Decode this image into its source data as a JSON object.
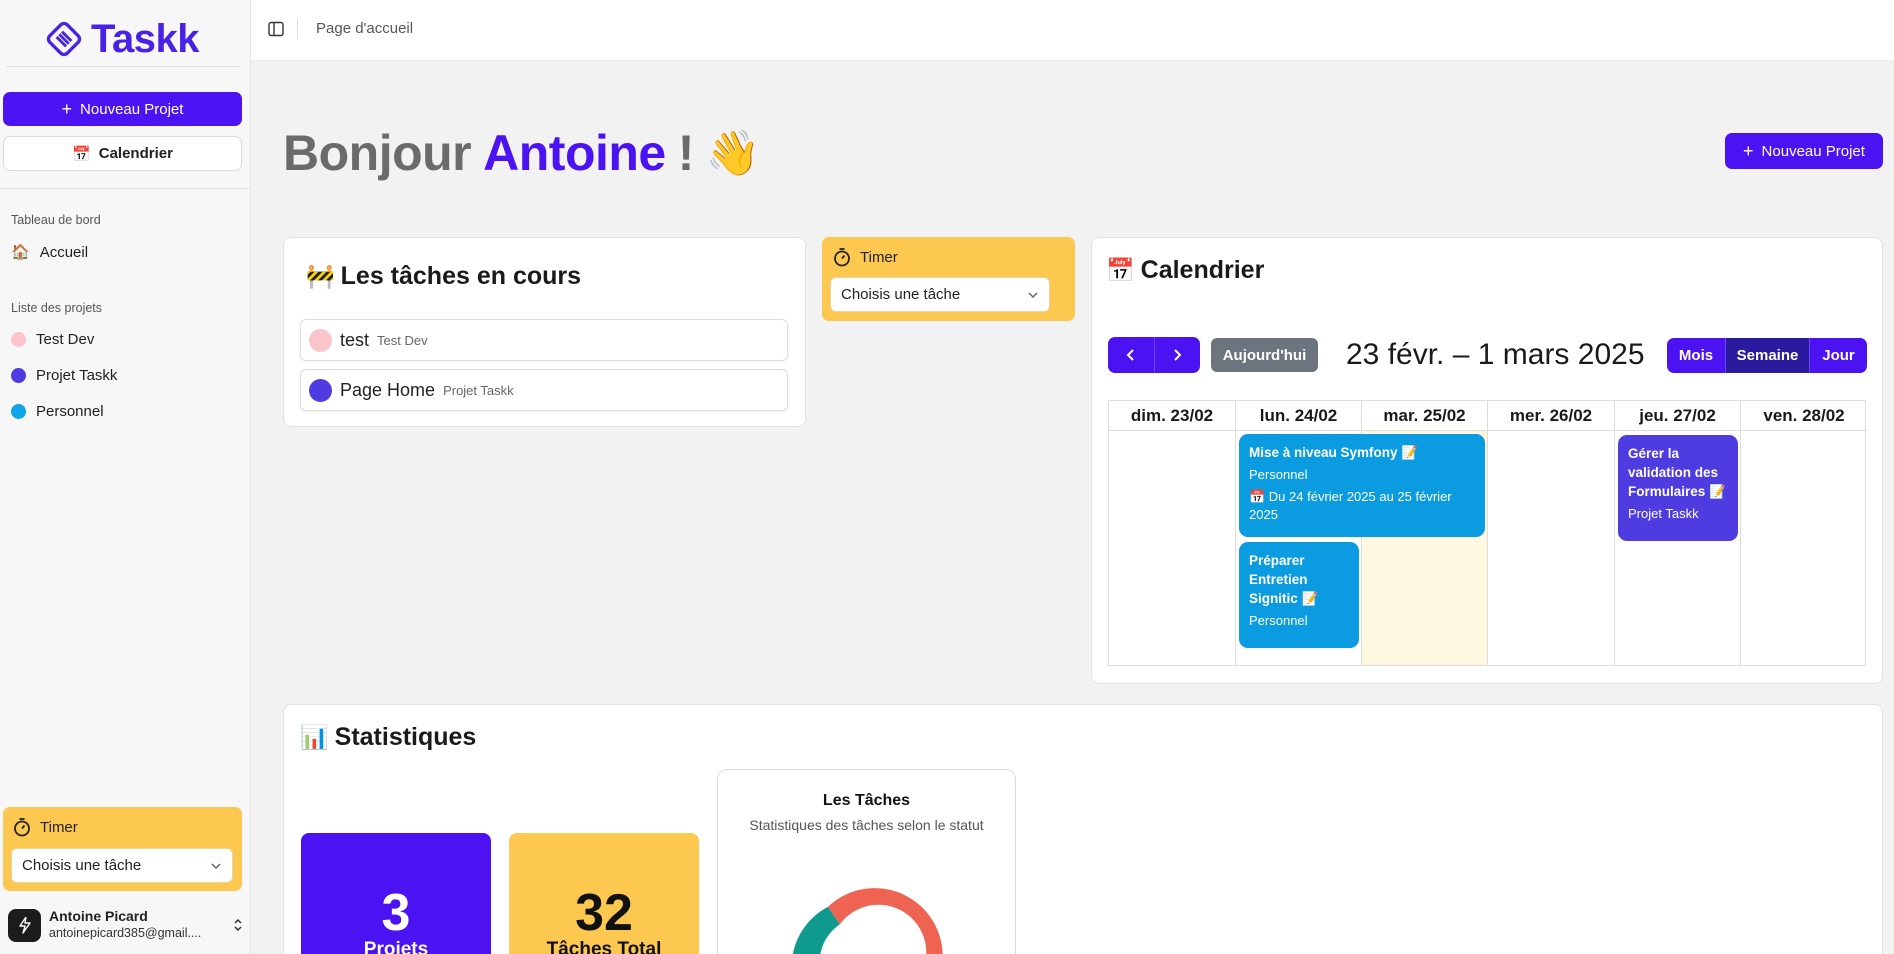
{
  "app": {
    "name": "Taskk"
  },
  "sidebar": {
    "new_project_label": "Nouveau Projet",
    "calendar_label": "Calendrier",
    "groups": [
      {
        "title": "Tableau de bord",
        "items": [
          {
            "label": "Accueil",
            "icon": "house-emoji"
          }
        ]
      },
      {
        "title": "Liste des projets",
        "items": [
          {
            "label": "Test Dev",
            "color": "#fbc4cb"
          },
          {
            "label": "Projet Taskk",
            "color": "#4f3ce0"
          },
          {
            "label": "Personnel",
            "color": "#0ea5e9"
          }
        ]
      }
    ],
    "timer": {
      "title": "Timer",
      "select_value": "Choisis une tâche"
    },
    "user": {
      "name": "Antoine Picard",
      "email": "antoinepicard385@gmail...."
    }
  },
  "topbar": {
    "breadcrumb": "Page d'accueil"
  },
  "greeting": {
    "prefix": "Bonjour",
    "name": "Antoine",
    "suffix": "!",
    "emoji": "👋"
  },
  "header_button": {
    "label": "Nouveau Projet"
  },
  "tasks_card": {
    "emoji": "🚧",
    "title": "Les tâches en cours",
    "items": [
      {
        "name": "test",
        "project": "Test Dev",
        "color": "#fbc4cb"
      },
      {
        "name": "Page Home",
        "project": "Projet Taskk",
        "color": "#4f3ce0"
      }
    ]
  },
  "timer_card": {
    "title": "Timer",
    "select_value": "Choisis une tâche"
  },
  "calendar": {
    "emoji": "📅",
    "title": "Calendrier",
    "today_label": "Aujourd'hui",
    "range": "23 févr. – 1 mars 2025",
    "views": [
      "Mois",
      "Semaine",
      "Jour"
    ],
    "active_view": "Semaine",
    "days": [
      "dim. 23/02",
      "lun. 24/02",
      "mar. 25/02",
      "mer. 26/02",
      "jeu. 27/02",
      "ven. 28/02"
    ],
    "today_index": 2,
    "events": [
      {
        "title": "Mise à niveau Symfony 📝",
        "project": "Personnel",
        "dates": "📅 Du 24 février 2025 au 25 février 2025",
        "color": "#0a9be0"
      },
      {
        "title": "Préparer Entretien Signitic 📝",
        "project": "Personnel",
        "color": "#0a9be0"
      },
      {
        "title": "Gérer la validation des Formulaires 📝",
        "project": "Projet Taskk",
        "color": "#4f3ce0"
      }
    ]
  },
  "stats": {
    "emoji": "📊",
    "title": "Statistiques",
    "boxes": [
      {
        "value": "3",
        "label": "Projets",
        "color": "#4b12f2"
      },
      {
        "value": "32",
        "label": "Tâches Total",
        "color": "#fdc850"
      }
    ],
    "donut": {
      "title": "Les Tâches",
      "subtitle": "Statistiques des tâches selon le statut",
      "colors": [
        "#ee6351",
        "#0e9a8c"
      ]
    }
  }
}
